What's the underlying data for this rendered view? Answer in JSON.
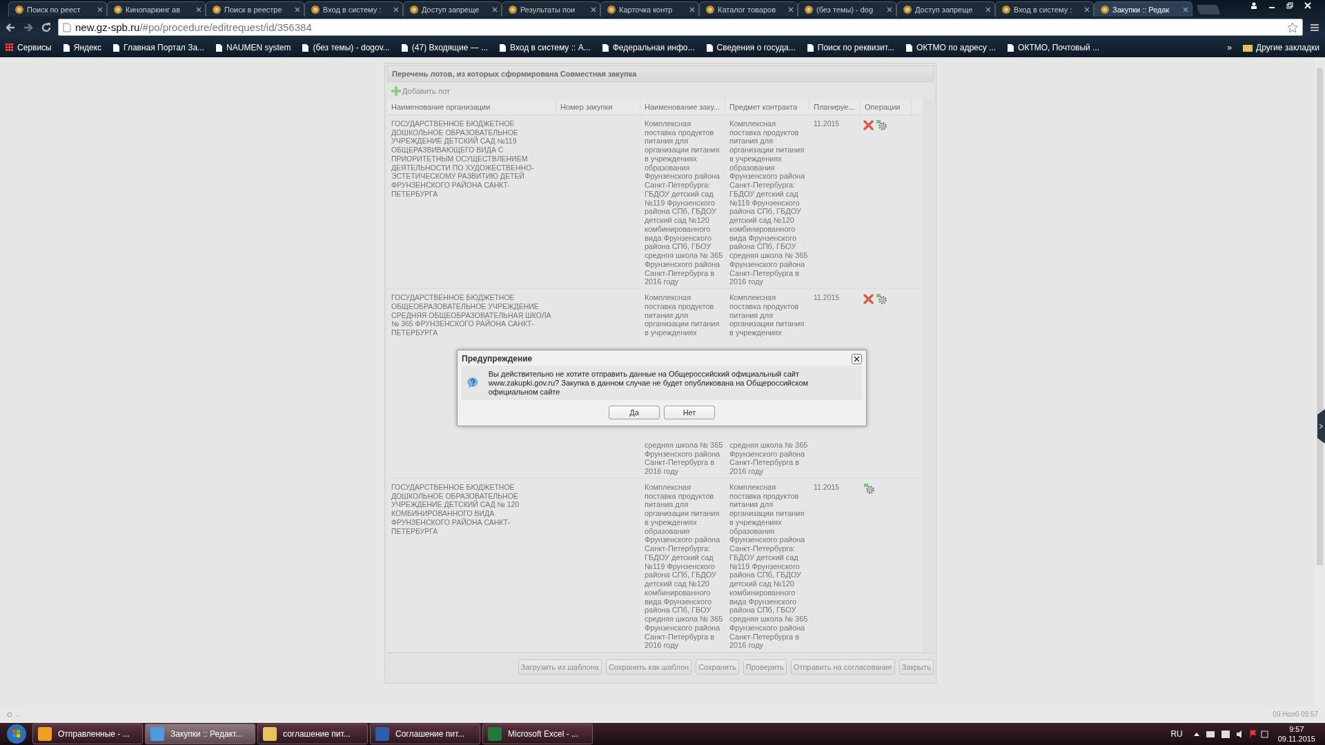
{
  "browser": {
    "tabs": [
      {
        "title": "Поиск по реест",
        "selected": false
      },
      {
        "title": "Кинопаркинг ав",
        "selected": false
      },
      {
        "title": "Поиск в реестре",
        "selected": false
      },
      {
        "title": "Вход в систему :",
        "selected": false
      },
      {
        "title": "Доступ запреще",
        "selected": false
      },
      {
        "title": "Результаты пои",
        "selected": false
      },
      {
        "title": "Карточка контр",
        "selected": false
      },
      {
        "title": "Каталог товаров",
        "selected": false
      },
      {
        "title": "(без темы) - dog",
        "selected": false
      },
      {
        "title": "Доступ запреще",
        "selected": false
      },
      {
        "title": "Вход в систему :",
        "selected": false
      },
      {
        "title": "Закупки :: Редак",
        "selected": true
      }
    ],
    "address": {
      "host": "new.gz-spb.ru",
      "path": "/#po/procedure/editrequest/id/356384"
    },
    "bookmarks": [
      "Сервисы",
      "Яндекс",
      "Главная Портал За...",
      "NAUMEN system",
      "(без темы) - dogov...",
      "(47) Входящие — ...",
      "Вход в систему :: А...",
      "Федеральная инфо...",
      "Сведения о госуда...",
      "Поиск по реквизит...",
      "ОКТМО по адресу ...",
      "ОКТМО, Почтовый ..."
    ],
    "bookmarks_more": "»",
    "other_bookmarks": "Другие закладки"
  },
  "panel": {
    "title": "Перечень лотов, из которых сформирована Совместная закупка",
    "add_button": "Добавить лот",
    "columns": [
      "Наименование организации",
      "Номер закупки",
      "Наименование заку...",
      "Предмет контракта",
      "Планируе...",
      "Операции"
    ],
    "rows": [
      {
        "organization": "ГОСУДАРСТВЕННОЕ БЮДЖЕТНОЕ ДОШКОЛЬНОЕ ОБРАЗОВАТЕЛЬНОЕ УЧРЕЖДЕНИЕ ДЕТСКИЙ САД №119 ОБЩЕРАЗВИВАЮЩЕГО ВИДА С ПРИОРИТЕТНЫМ ОСУЩЕСТВЛЕНИЕМ ДЕЯТЕЛЬНОСТИ ПО ХУДОЖЕСТВЕННО-ЭСТЕТИЧЕСКОМУ РАЗВИТИЮ ДЕТЕЙ ФРУНЗЕНСКОГО РАЙОНА САНКТ-ПЕТЕРБУРГА",
        "name": [
          "Комплексная поставка продуктов питания для организации питания в учреждениях образования Фрунзенского района Санкт-Петербурга: ГБДОУ детский сад №119 Фрунзенского района СПб, ГБДОУ детский сад №120 комбинированного вида Фрунзенского района СПб, ГБОУ средняя школа № 365 Фрунзенского района Санкт-Петербурга в 2016 году"
        ],
        "subject": [
          "Комплексная поставка продуктов питания для организации питания в учреждениях образования Фрунзенского района Санкт-Петербурга: ГБДОУ детский сад №119 Фрунзенского района СПб, ГБДОУ детский сад №120 комбинированного вида Фрунзенского района СПб, ГБОУ средняя школа № 365 Фрунзенского района Санкт-Петербурга в 2016 году"
        ],
        "planned": "11.2015",
        "deletable": true
      },
      {
        "organization": "ГОСУДАРСТВЕННОЕ БЮДЖЕТНОЕ ОБЩЕОБРАЗОВАТЕЛЬНОЕ УЧРЕЖДЕНИЕ СРЕДНЯЯ ОБЩЕОБРАЗОВАТЕЛЬНАЯ ШКОЛА № 365 ФРУНЗЕНСКОГО РАЙОНА САНКТ-ПЕТЕРБУРГА",
        "name": [
          "Комплексная поставка продуктов питания для организации питания в учреждениях",
          "средняя школа № 365 Фрунзенского района Санкт-Петербурга в 2016 году"
        ],
        "subject": [
          "Комплексная поставка продуктов питания для организации питания в учреждениях",
          "средняя школа № 365 Фрунзенского района Санкт-Петербурга в 2016 году"
        ],
        "planned": "11.2015",
        "deletable": true
      },
      {
        "organization": "ГОСУДАРСТВЕННОЕ БЮДЖЕТНОЕ ДОШКОЛЬНОЕ ОБРАЗОВАТЕЛЬНОЕ УЧРЕЖДЕНИЕ ДЕТСКИЙ САД № 120 КОМБИНИРОВАННОГО ВИДА ФРУНЗЕНСКОГО РАЙОНА САНКТ-ПЕТЕРБУРГА",
        "name": [
          "Комплексная поставка продуктов питания для организации питания в учреждениях образования Фрунзенского района Санкт-Петербурга: ГБДОУ детский сад №119 Фрунзенского района СПб, ГБДОУ детский сад №120 комбинированного вида Фрунзенского района СПб, ГБОУ средняя школа № 365 Фрунзенского района Санкт-Петербурга в 2016 году"
        ],
        "subject": [
          "Комплексная поставка продуктов питания для организации питания в учреждениях образования Фрунзенского района Санкт-Петербурга: ГБДОУ детский сад №119 Фрунзенского района СПб, ГБДОУ детский сад №120 комбинированного вида Фрунзенского района СПб, ГБОУ средняя школа № 365 Фрунзенского района Санкт-Петербурга в 2016 году"
        ],
        "planned": "11.2015",
        "deletable": false
      }
    ],
    "buttons": [
      "Загрузить из шаблона",
      "Сохранить как шаблон",
      "Сохранить",
      "Проверить",
      "Отправить на согласование",
      "Закрыть"
    ]
  },
  "dialog": {
    "title": "Предупреждение",
    "message": "Вы действительно не хотите отправить данные на Общероссийский официальный сайт www.zakupki.gov.ru? Закупка в данном случае не будет опубликована на Общероссийском официальном сайте",
    "buttons": [
      "Да",
      "Нет"
    ]
  },
  "status_bar": {
    "left": "...",
    "right": "09 Нояб 09:57"
  },
  "taskbar": {
    "items": [
      {
        "label": "Отправленные - ...",
        "selected": false
      },
      {
        "label": "Закупки :: Редакт...",
        "selected": true
      },
      {
        "label": "соглашение пит...",
        "selected": false
      },
      {
        "label": "Соглашение пит...",
        "selected": false
      },
      {
        "label": "Microsoft Excel - ...",
        "selected": false
      }
    ],
    "language": "RU",
    "time": "9:57",
    "date": "09.11.2015"
  }
}
